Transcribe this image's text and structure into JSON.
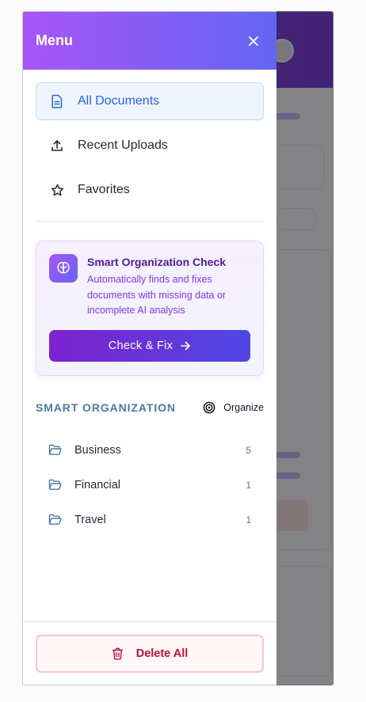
{
  "drawer": {
    "title": "Menu",
    "close_icon": "close-icon"
  },
  "nav": {
    "items": [
      {
        "label": "All Documents",
        "icon": "document-icon",
        "active": true
      },
      {
        "label": "Recent Uploads",
        "icon": "upload-icon",
        "active": false
      },
      {
        "label": "Favorites",
        "icon": "star-icon",
        "active": false
      }
    ]
  },
  "smart_check": {
    "title": "Smart Organization Check",
    "description": "Automatically finds and fixes documents with missing data or incomplete AI analysis",
    "button_label": "Check & Fix",
    "icon": "brain-icon"
  },
  "smart_organization": {
    "heading": "SMART ORGANIZATION",
    "organize_label": "Organize",
    "folders": [
      {
        "name": "Business",
        "count": "5"
      },
      {
        "name": "Financial",
        "count": "1"
      },
      {
        "name": "Travel",
        "count": "1"
      }
    ]
  },
  "footer": {
    "delete_label": "Delete All"
  },
  "colors": {
    "header_gradient_start": "#a855f7",
    "header_gradient_end": "#6366f1",
    "active_nav_text": "#2563eb",
    "danger": "#be123c"
  }
}
